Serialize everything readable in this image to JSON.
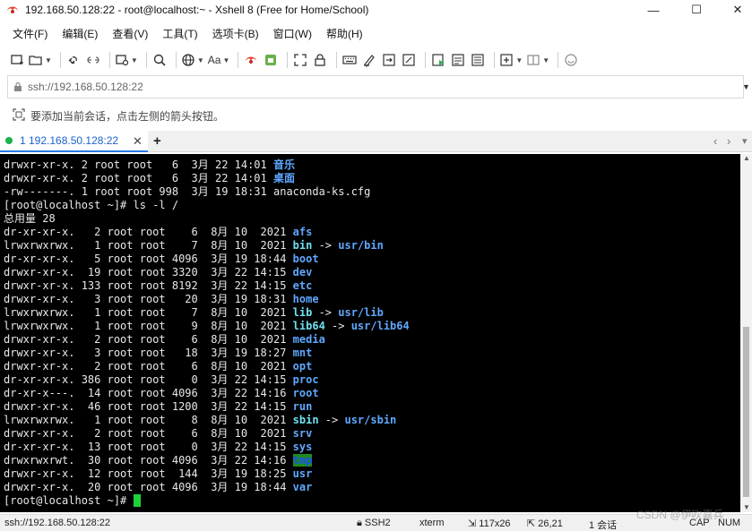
{
  "window": {
    "title": "192.168.50.128:22 - root@localhost:~ - Xshell 8 (Free for Home/School)",
    "minimize": "—",
    "maximize": "☐",
    "close": "✕"
  },
  "menu": [
    "文件(F)",
    "编辑(E)",
    "查看(V)",
    "工具(T)",
    "选项卡(B)",
    "窗口(W)",
    "帮助(H)"
  ],
  "address": {
    "value": "ssh://192.168.50.128:22"
  },
  "hint": "要添加当前会话，点击左侧的箭头按钮。",
  "toolbar": {
    "font_label": "Aa"
  },
  "tab": {
    "label": "1 192.168.50.128:22",
    "close": "✕",
    "add": "+"
  },
  "terminal": {
    "pre1": [
      "drwxr-xr-x. 2 root root   6  3月 22 14:01 ",
      "drwxr-xr-x. 2 root root   6  3月 22 14:01 ",
      "-rw-------. 1 root root 998  3月 19 18:31 "
    ],
    "pre1_names": [
      "音乐",
      "桌面",
      "anaconda-ks.cfg"
    ],
    "command_line": "[root@localhost ~]# ls -l /",
    "total_line": "总用量 28",
    "entries": [
      {
        "perm": "dr-xr-xr-x.   2 root root    6  8月 10  2021 ",
        "name": "afs",
        "link": ""
      },
      {
        "perm": "lrwxrwxrwx.   1 root root    7  8月 10  2021 ",
        "name": "bin",
        "link": "usr/bin"
      },
      {
        "perm": "dr-xr-xr-x.   5 root root 4096  3月 19 18:44 ",
        "name": "boot",
        "link": ""
      },
      {
        "perm": "drwxr-xr-x.  19 root root 3320  3月 22 14:15 ",
        "name": "dev",
        "link": ""
      },
      {
        "perm": "drwxr-xr-x. 133 root root 8192  3月 22 14:15 ",
        "name": "etc",
        "link": ""
      },
      {
        "perm": "drwxr-xr-x.   3 root root   20  3月 19 18:31 ",
        "name": "home",
        "link": ""
      },
      {
        "perm": "lrwxrwxrwx.   1 root root    7  8月 10  2021 ",
        "name": "lib",
        "link": "usr/lib"
      },
      {
        "perm": "lrwxrwxrwx.   1 root root    9  8月 10  2021 ",
        "name": "lib64",
        "link": "usr/lib64"
      },
      {
        "perm": "drwxr-xr-x.   2 root root    6  8月 10  2021 ",
        "name": "media",
        "link": ""
      },
      {
        "perm": "drwxr-xr-x.   3 root root   18  3月 19 18:27 ",
        "name": "mnt",
        "link": ""
      },
      {
        "perm": "drwxr-xr-x.   2 root root    6  8月 10  2021 ",
        "name": "opt",
        "link": ""
      },
      {
        "perm": "dr-xr-xr-x. 386 root root    0  3月 22 14:15 ",
        "name": "proc",
        "link": ""
      },
      {
        "perm": "dr-xr-x---.  14 root root 4096  3月 22 14:16 ",
        "name": "root",
        "link": ""
      },
      {
        "perm": "drwxr-xr-x.  46 root root 1200  3月 22 14:15 ",
        "name": "run",
        "link": ""
      },
      {
        "perm": "lrwxrwxrwx.   1 root root    8  8月 10  2021 ",
        "name": "sbin",
        "link": "usr/sbin"
      },
      {
        "perm": "drwxr-xr-x.   2 root root    6  8月 10  2021 ",
        "name": "srv",
        "link": ""
      },
      {
        "perm": "dr-xr-xr-x.  13 root root    0  3月 22 14:15 ",
        "name": "sys",
        "link": ""
      },
      {
        "perm": "drwxrwxrwt.  30 root root 4096  3月 22 14:16 ",
        "name": "tmp",
        "link": "",
        "sticky": true
      },
      {
        "perm": "drwxr-xr-x.  12 root root  144  3月 19 18:25 ",
        "name": "usr",
        "link": ""
      },
      {
        "perm": "drwxr-xr-x.  20 root root 4096  3月 19 18:44 ",
        "name": "var",
        "link": ""
      }
    ],
    "prompt": "[root@localhost ~]# ",
    "link_arrow": " -> "
  },
  "status": {
    "connection": "ssh://192.168.50.128:22",
    "protocol": "SSH2",
    "term": "xterm",
    "size": "117x26",
    "cursor_pos": "26,21",
    "sessions": "1 会话",
    "cap": "CAP",
    "num": "NUM"
  },
  "watermark": "CSDN @伊吹嘉兵",
  "colors": {
    "dir": "#5fa8ff",
    "link": "#6fe0f0",
    "tab_accent": "#2a7ae2",
    "cursor": "#1ed23a",
    "tmp_bg": "#1f8a1f"
  },
  "icons": [
    "xshell-logo-icon",
    "new-session-icon",
    "open-folder-icon",
    "connect-icon",
    "disconnect-icon",
    "reconnect-icon",
    "search-icon",
    "globe-icon",
    "font-icon",
    "xshell-icon",
    "xftp-icon",
    "fullscreen-icon",
    "lock-icon",
    "keyboard-icon",
    "script-icon",
    "transfer-icon",
    "compose-icon",
    "play-icon",
    "log-icon",
    "notes-icon",
    "add-tab-icon",
    "layout-icon",
    "help-icon"
  ]
}
